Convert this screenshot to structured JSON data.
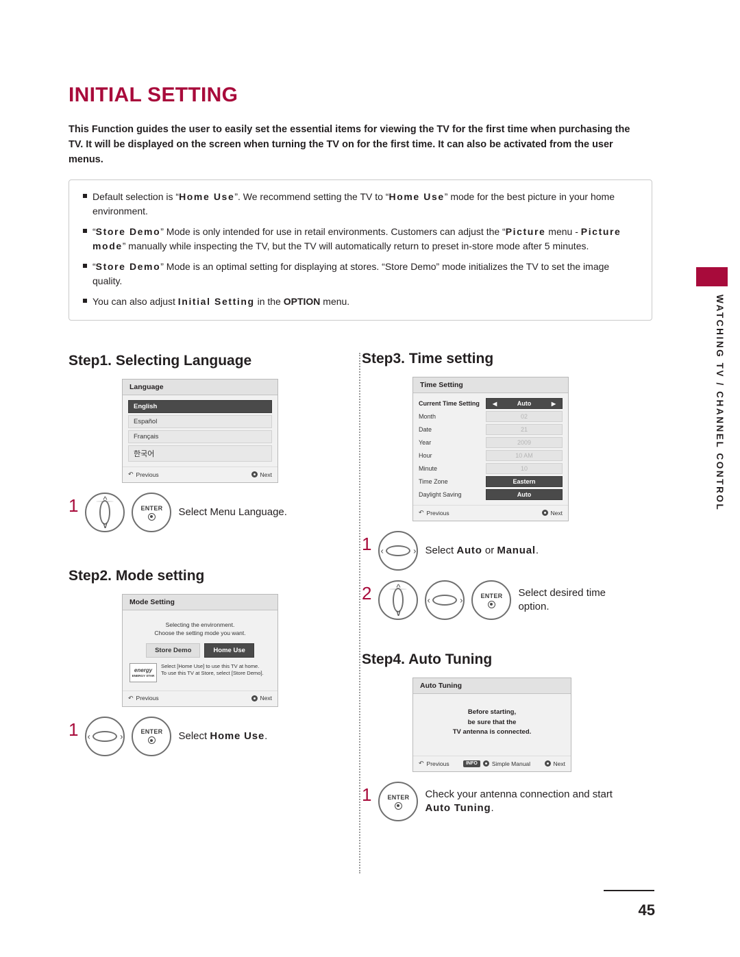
{
  "page": {
    "title": "INITIAL SETTING",
    "number": "45",
    "side_tab": "WATCHING TV / CHANNEL CONTROL"
  },
  "intro": "This Function guides the user to easily set the essential items for viewing the TV for the first time when purchasing the TV. It will be displayed on the screen when turning the TV on for the first time. It can also be activated from the user menus.",
  "bullets": [
    {
      "parts": [
        {
          "t": "Default selection is “",
          "s": "n"
        },
        {
          "t": "Home Use",
          "s": "sp"
        },
        {
          "t": "”. We recommend setting the TV to “",
          "s": "n"
        },
        {
          "t": "Home Use",
          "s": "sp"
        },
        {
          "t": "” mode for the best picture in your home environment.",
          "s": "n"
        }
      ]
    },
    {
      "parts": [
        {
          "t": "“",
          "s": "n"
        },
        {
          "t": "Store Demo",
          "s": "sp"
        },
        {
          "t": "” Mode is only intended for use in retail environments. Customers can adjust the “",
          "s": "n"
        },
        {
          "t": "Picture",
          "s": "sp"
        },
        {
          "t": " menu - ",
          "s": "n"
        },
        {
          "t": "Picture mode",
          "s": "sp"
        },
        {
          "t": "” manually while inspecting the TV, but the TV will automatically return to preset in-store mode after 5 minutes.",
          "s": "n"
        }
      ]
    },
    {
      "parts": [
        {
          "t": "“",
          "s": "n"
        },
        {
          "t": "Store Demo",
          "s": "sp"
        },
        {
          "t": "” Mode is an optimal setting for displaying at stores. “Store Demo” mode initializes the TV to set the image quality.",
          "s": "n"
        }
      ]
    },
    {
      "parts": [
        {
          "t": "You can also adjust ",
          "s": "n"
        },
        {
          "t": "Initial Setting",
          "s": "sp"
        },
        {
          "t": " in the ",
          "s": "n"
        },
        {
          "t": "OPTION",
          "s": "b"
        },
        {
          "t": " menu.",
          "s": "n"
        }
      ]
    }
  ],
  "steps": {
    "step1": {
      "heading_num": "Step1.",
      "heading_text": " Selecting Language",
      "osd": {
        "title": "Language",
        "rows": [
          {
            "label": "English",
            "selected": true
          },
          {
            "label": "Español",
            "selected": false
          },
          {
            "label": "Français",
            "selected": false
          },
          {
            "label": "한국어",
            "selected": false,
            "kr": true
          }
        ],
        "prev": "Previous",
        "next": "Next"
      },
      "num": "1",
      "instruction": "Select Menu Language."
    },
    "step2": {
      "heading_num": "Step2.",
      "heading_text": " Mode setting",
      "osd": {
        "title": "Mode Setting",
        "line1": "Selecting the environment.",
        "line2": "Choose the setting mode you want.",
        "btn_store": "Store Demo",
        "btn_home": "Home Use",
        "estar_brand": "energy",
        "estar_label": "ENERGY STAR",
        "estar_text_1": "Select [Home Use] to use this TV at home.",
        "estar_text_2": "To use this TV at Store, select [Store Demo].",
        "prev": "Previous",
        "next": "Next"
      },
      "num": "1",
      "instruction_pre": "Select ",
      "instruction_key": "Home Use",
      "instruction_post": "."
    },
    "step3": {
      "heading_num": "Step3.",
      "heading_text": " Time setting",
      "osd": {
        "title": "Time Setting",
        "rows": [
          {
            "label": "Current Time Setting",
            "value": "Auto",
            "style": "arrows"
          },
          {
            "label": "Month",
            "value": "02",
            "style": "dim"
          },
          {
            "label": "Date",
            "value": "21",
            "style": "dim"
          },
          {
            "label": "Year",
            "value": "2009",
            "style": "dim"
          },
          {
            "label": "Hour",
            "value": "10 AM",
            "style": "dim"
          },
          {
            "label": "Minute",
            "value": "10",
            "style": "dim"
          },
          {
            "label": "Time Zone",
            "value": "Eastern",
            "style": "dark"
          },
          {
            "label": "Daylight Saving",
            "value": "Auto",
            "style": "dark"
          }
        ],
        "prev": "Previous",
        "next": "Next"
      },
      "num1": "1",
      "instr1_pre": "Select ",
      "instr1_k1": "Auto",
      "instr1_mid": " or ",
      "instr1_k2": "Manual",
      "instr1_post": ".",
      "num2": "2",
      "instr2": "Select desired time option."
    },
    "step4": {
      "heading_num": "Step4.",
      "heading_text": " Auto Tuning",
      "osd": {
        "title": "Auto Tuning",
        "line1": "Before starting,",
        "line2": "be sure that the",
        "line3": "TV antenna is connected.",
        "prev": "Previous",
        "info_chip": "INFO",
        "simple_manual": "Simple Manual",
        "next": "Next"
      },
      "num": "1",
      "instr_line1": "Check your antenna connection and start",
      "instr_key": "Auto Tuning",
      "instr_post": "."
    }
  },
  "keys": {
    "enter_label": "ENTER"
  },
  "colors": {
    "accent": "#a80b3b",
    "text": "#231f20",
    "osd_selected": "#4a4a4a"
  }
}
